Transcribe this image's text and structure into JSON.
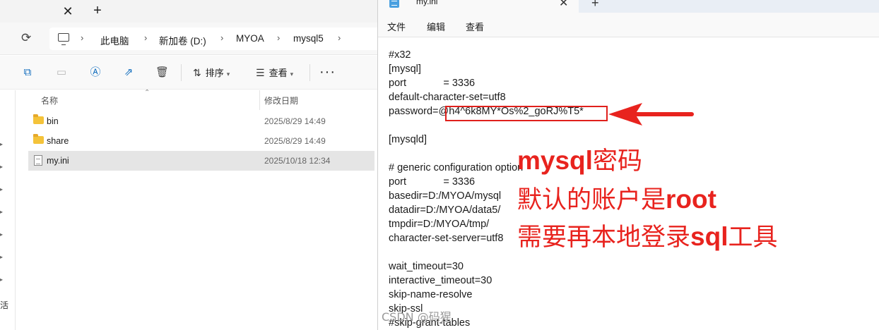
{
  "explorer": {
    "address": {
      "crumbs": [
        "此电脑",
        "新加卷 (D:)",
        "MYOA",
        "mysql5"
      ]
    },
    "toolbar": {
      "sort_label": "排序",
      "view_label": "查看"
    },
    "columns": {
      "name": "名称",
      "date_modified": "修改日期"
    },
    "files": [
      {
        "name": "bin",
        "date": "2025/8/29 14:49",
        "icon": "folder-icon",
        "selected": false
      },
      {
        "name": "share",
        "date": "2025/8/29 14:49",
        "icon": "folder-icon",
        "selected": false
      },
      {
        "name": "my.ini",
        "date": "2025/10/18 12:34",
        "icon": "ini-file-icon",
        "selected": true
      }
    ],
    "nav_partial_char": "活"
  },
  "notepad": {
    "tab_title": "my.ini",
    "menu": [
      "文件",
      "编辑",
      "查看"
    ],
    "lines": [
      "#x32",
      "[mysql]",
      "port             = 3336",
      "default-character-set=utf8",
      "password=@h4^6k8MY*Os%2_goRJ%T5*",
      "",
      "[mysqld]",
      "",
      "# generic configuration option",
      "port             = 3336",
      "basedir=D:/MYOA/mysql",
      "datadir=D:/MYOA/data5/",
      "tmpdir=D:/MYOA/tmp/",
      "character-set-server=utf8",
      "",
      "wait_timeout=30",
      "interactive_timeout=30",
      "skip-name-resolve",
      "skip-ssl",
      "#skip-grant-tables"
    ]
  },
  "annotations": {
    "line1_bold": "mysql",
    "line1_rest": "密码",
    "line2_rest": "默认的账户是",
    "line2_bold": "root",
    "line3_rest_a": "需要再本地登录",
    "line3_bold": "sql",
    "line3_rest_b": "工具",
    "color": "#e8231e"
  },
  "watermark": "CSDN @码猩",
  "colors": {
    "accent": "#0f6cbd",
    "highlight": "#e0201c",
    "selected_row": "#e5e5e5"
  }
}
